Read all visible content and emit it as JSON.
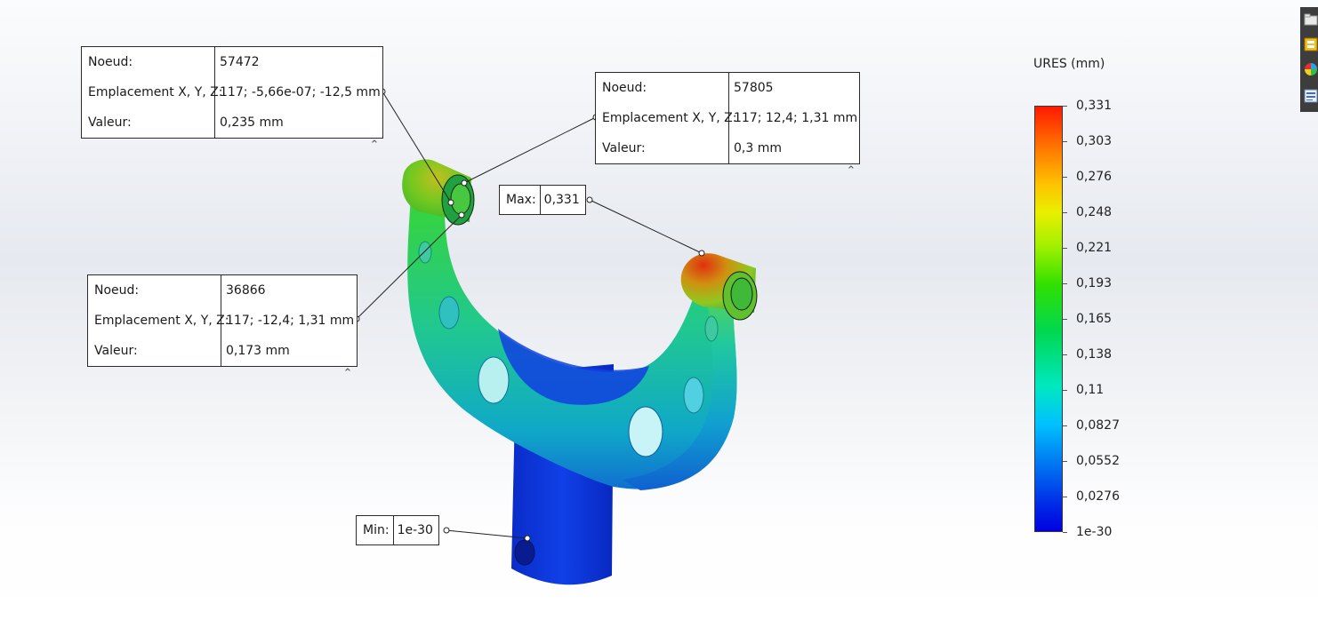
{
  "probes": [
    {
      "rows": [
        {
          "key": "Noeud:",
          "value": "57472"
        },
        {
          "key": "Emplacement X, Y, Z:",
          "value": "117; -5,66e-07; -12,5 mm"
        },
        {
          "key": "Valeur:",
          "value": "0,235 mm"
        }
      ]
    },
    {
      "rows": [
        {
          "key": "Noeud:",
          "value": "57805"
        },
        {
          "key": "Emplacement X, Y, Z:",
          "value": "117; 12,4; 1,31 mm"
        },
        {
          "key": "Valeur:",
          "value": "0,3 mm"
        }
      ]
    },
    {
      "rows": [
        {
          "key": "Noeud:",
          "value": "36866"
        },
        {
          "key": "Emplacement X, Y, Z:",
          "value": "117; -12,4; 1,31 mm"
        },
        {
          "key": "Valeur:",
          "value": "0,173 mm"
        }
      ]
    }
  ],
  "max_tag": {
    "key": "Max:",
    "value": "0,331"
  },
  "min_tag": {
    "key": "Min:",
    "value": "1e-30"
  },
  "legend": {
    "title": "URES (mm)",
    "labels": [
      "0,331",
      "0,303",
      "0,276",
      "0,248",
      "0,221",
      "0,193",
      "0,165",
      "0,138",
      "0,11",
      "0,0827",
      "0,0552",
      "0,0276",
      "1e-30"
    ]
  },
  "collapse_glyph": "⌃",
  "toolbar": {
    "icons": [
      "folder-icon",
      "display-manager-icon",
      "appearance-icon",
      "list-icon"
    ]
  }
}
